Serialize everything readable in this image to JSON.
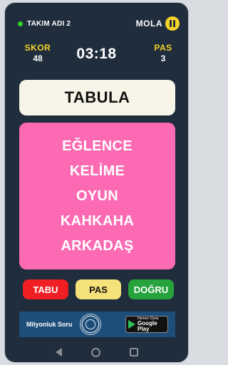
{
  "header": {
    "team_name": "TAKIM ADI 2",
    "pause_label": "MOLA"
  },
  "score": {
    "score_label": "SKOR",
    "score_value": "48",
    "timer": "03:18",
    "pass_label": "PAS",
    "pass_value": "3"
  },
  "card": {
    "word": "TABULA",
    "forbidden": [
      "EĞLENCE",
      "KELİME",
      "OYUN",
      "KAHKAHA",
      "ARKADAŞ"
    ]
  },
  "actions": {
    "tabu_label": "TABU",
    "pass_label": "PAS",
    "correct_label": "DOĞRU"
  },
  "ad": {
    "title": "Milyonluk Soru",
    "store_small": "Hemen Oyna",
    "store_big": "Google Play"
  },
  "colors": {
    "background": "#1f2d3d",
    "accent_yellow": "#f4d32a",
    "card_pink": "#fb6ab2",
    "tabu_red": "#ef1f24",
    "pass_yellow": "#f6e27a",
    "correct_green": "#27a33d",
    "status_green": "#2fd12a"
  }
}
